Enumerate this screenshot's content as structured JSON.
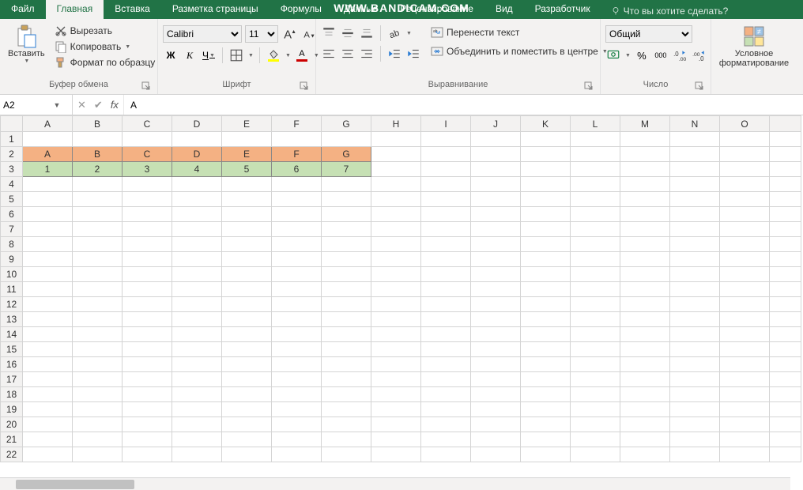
{
  "watermark": "WWW.BANDICAM.COM",
  "tabs": [
    "Файл",
    "Главная",
    "Вставка",
    "Разметка страницы",
    "Формулы",
    "Данные",
    "Рецензирование",
    "Вид",
    "Разработчик"
  ],
  "active_tab_index": 1,
  "tell_me": "Что вы хотите сделать?",
  "clipboard": {
    "paste": "Вставить",
    "cut": "Вырезать",
    "copy": "Копировать",
    "painter": "Формат по образцу",
    "group": "Буфер обмена"
  },
  "font": {
    "name": "Calibri",
    "size": "11",
    "bold": "Ж",
    "italic": "К",
    "underline": "Ч",
    "group": "Шрифт"
  },
  "align": {
    "wrap": "Перенести текст",
    "merge": "Объединить и поместить в центре",
    "group": "Выравнивание"
  },
  "number": {
    "format": "Общий",
    "percent": "%",
    "comma": "000",
    "group": "Число"
  },
  "cond": {
    "label1": "Условное",
    "label2": "форматирование"
  },
  "namebox": "A2",
  "formula": "A",
  "columns": [
    "A",
    "B",
    "C",
    "D",
    "E",
    "F",
    "G",
    "H",
    "I",
    "J",
    "K",
    "L",
    "M",
    "N",
    "O"
  ],
  "rows": 22,
  "data_rows": [
    {
      "style": "orange",
      "cells": [
        "A",
        "B",
        "C",
        "D",
        "E",
        "F",
        "G"
      ]
    },
    {
      "style": "green",
      "cells": [
        "1",
        "2",
        "3",
        "4",
        "5",
        "6",
        "7"
      ]
    }
  ],
  "data_start_row": 2
}
